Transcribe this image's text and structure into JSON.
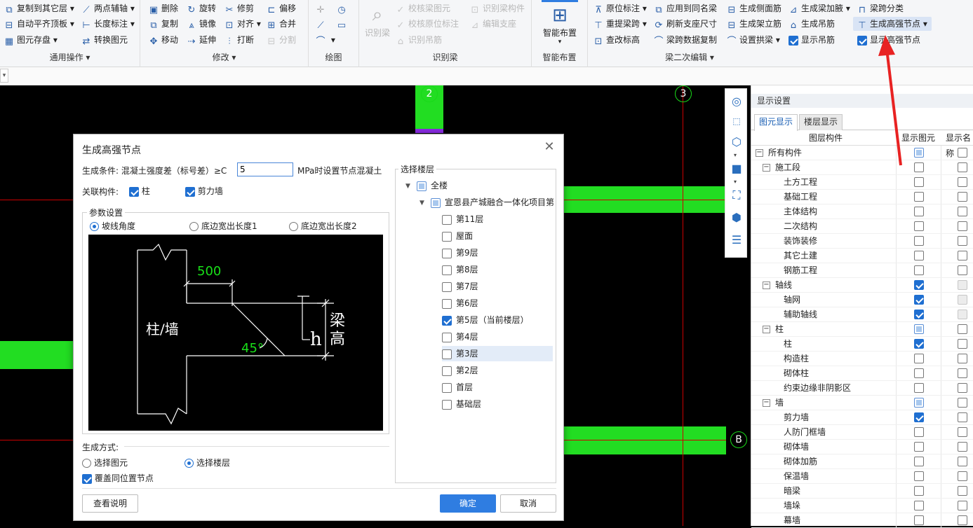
{
  "ribbon": {
    "groups": {
      "common": {
        "label": "通用操作",
        "items": [
          "复制到其它层",
          "两点辅轴",
          "自动平齐顶板",
          "长度标注",
          "图元存盘",
          "转换图元"
        ]
      },
      "modify": {
        "label": "修改",
        "items": [
          "删除",
          "旋转",
          "修剪",
          "偏移",
          "复制",
          "镜像",
          "对齐",
          "合并",
          "移动",
          "延伸",
          "打断",
          "分割"
        ]
      },
      "draw": {
        "label": "绘图"
      },
      "identify": {
        "label": "识别梁",
        "big": "识别梁",
        "items": [
          "校核梁图元",
          "识别梁构件",
          "校核原位标注",
          "编辑支座",
          "识别吊筋"
        ]
      },
      "smart": {
        "label": "智能布置",
        "big": "智能布置"
      },
      "beam_edit": {
        "label": "梁二次编辑",
        "items": [
          "原位标注",
          "应用到同名梁",
          "生成侧面筋",
          "生成梁加腋",
          "梁跨分类",
          "重提梁跨",
          "刷新支座尺寸",
          "生成架立筋",
          "生成吊筋",
          "生成高强节点",
          "查改标高",
          "梁跨数据复制",
          "设置拱梁",
          "显示吊筋",
          "显示高强节点"
        ]
      }
    }
  },
  "canvas": {
    "axis_labels": [
      "2",
      "3",
      "B"
    ]
  },
  "panel": {
    "title": "显示设置",
    "tabs": [
      "图元显示",
      "楼层显示"
    ],
    "columns": [
      "图层构件",
      "显示图元",
      "显示名称"
    ],
    "rows": [
      {
        "name": "所有构件",
        "level": 0,
        "expander": "−",
        "c1": "part",
        "c2": "off"
      },
      {
        "name": "施工段",
        "level": 1,
        "expander": "−",
        "c1": "off",
        "c2": "off"
      },
      {
        "name": "土方工程",
        "level": 2,
        "c1": "off",
        "c2": "off"
      },
      {
        "name": "基础工程",
        "level": 2,
        "c1": "off",
        "c2": "off"
      },
      {
        "name": "主体结构",
        "level": 2,
        "c1": "off",
        "c2": "off"
      },
      {
        "name": "二次结构",
        "level": 2,
        "c1": "off",
        "c2": "off"
      },
      {
        "name": "装饰装修",
        "level": 2,
        "c1": "off",
        "c2": "off"
      },
      {
        "name": "其它土建",
        "level": 2,
        "c1": "off",
        "c2": "off"
      },
      {
        "name": "钢筋工程",
        "level": 2,
        "c1": "off",
        "c2": "off"
      },
      {
        "name": "轴线",
        "level": 1,
        "expander": "−",
        "c1": "on",
        "c2": "dis"
      },
      {
        "name": "轴网",
        "level": 2,
        "c1": "on",
        "c2": "dis"
      },
      {
        "name": "辅助轴线",
        "level": 2,
        "c1": "on",
        "c2": "dis"
      },
      {
        "name": "柱",
        "level": 1,
        "expander": "−",
        "c1": "part",
        "c2": "off"
      },
      {
        "name": "柱",
        "level": 2,
        "c1": "on",
        "c2": "off"
      },
      {
        "name": "构造柱",
        "level": 2,
        "c1": "off",
        "c2": "off"
      },
      {
        "name": "砌体柱",
        "level": 2,
        "c1": "off",
        "c2": "off"
      },
      {
        "name": "约束边缘非阴影区",
        "level": 2,
        "c1": "off",
        "c2": "off"
      },
      {
        "name": "墙",
        "level": 1,
        "expander": "−",
        "c1": "part",
        "c2": "off"
      },
      {
        "name": "剪力墙",
        "level": 2,
        "c1": "on",
        "c2": "off"
      },
      {
        "name": "人防门框墙",
        "level": 2,
        "c1": "off",
        "c2": "off"
      },
      {
        "name": "砌体墙",
        "level": 2,
        "c1": "off",
        "c2": "off"
      },
      {
        "name": "砌体加筋",
        "level": 2,
        "c1": "off",
        "c2": "off"
      },
      {
        "name": "保温墙",
        "level": 2,
        "c1": "off",
        "c2": "off"
      },
      {
        "name": "暗梁",
        "level": 2,
        "c1": "off",
        "c2": "off"
      },
      {
        "name": "墙垛",
        "level": 2,
        "c1": "off",
        "c2": "off"
      },
      {
        "name": "幕墙",
        "level": 2,
        "c1": "off",
        "c2": "off"
      }
    ]
  },
  "dialog": {
    "title": "生成高强节点",
    "condition_prefix": "生成条件:  混凝土强度差（标号差）≥C",
    "condition_value": "5",
    "condition_suffix": "MPa时设置节点混凝土",
    "related_label": "关联构件:",
    "related": [
      {
        "label": "柱",
        "checked": true
      },
      {
        "label": "剪力墙",
        "checked": true
      }
    ],
    "params_legend": "参数设置",
    "params_options": [
      "坡线角度",
      "底边宽出长度1",
      "底边宽出长度2"
    ],
    "params_selected": 0,
    "diagram": {
      "label_wall": "柱/墙",
      "label_500": "500",
      "label_45": "45°",
      "label_h": "h",
      "label_beam": "梁",
      "label_height": "高"
    },
    "gen_mode_label": "生成方式:",
    "gen_modes": [
      "选择图元",
      "选择楼层"
    ],
    "gen_mode_selected": 1,
    "overwrite_label": "覆盖同位置节点",
    "overwrite_checked": true,
    "floors_legend": "选择楼层",
    "floor_root": "全楼",
    "floor_project": "宣恩县产城融合一体化项目第",
    "floors": [
      {
        "name": "第11层",
        "checked": false
      },
      {
        "name": "屋面",
        "checked": false
      },
      {
        "name": "第9层",
        "checked": false
      },
      {
        "name": "第8层",
        "checked": false
      },
      {
        "name": "第7层",
        "checked": false
      },
      {
        "name": "第6层",
        "checked": false
      },
      {
        "name": "第5层（当前楼层）",
        "checked": true
      },
      {
        "name": "第4层",
        "checked": false
      },
      {
        "name": "第3层",
        "checked": false,
        "highlight": true
      },
      {
        "name": "第2层",
        "checked": false
      },
      {
        "name": "首层",
        "checked": false
      },
      {
        "name": "基础层",
        "checked": false
      }
    ],
    "btn_help": "查看说明",
    "btn_ok": "确定",
    "btn_cancel": "取消"
  }
}
